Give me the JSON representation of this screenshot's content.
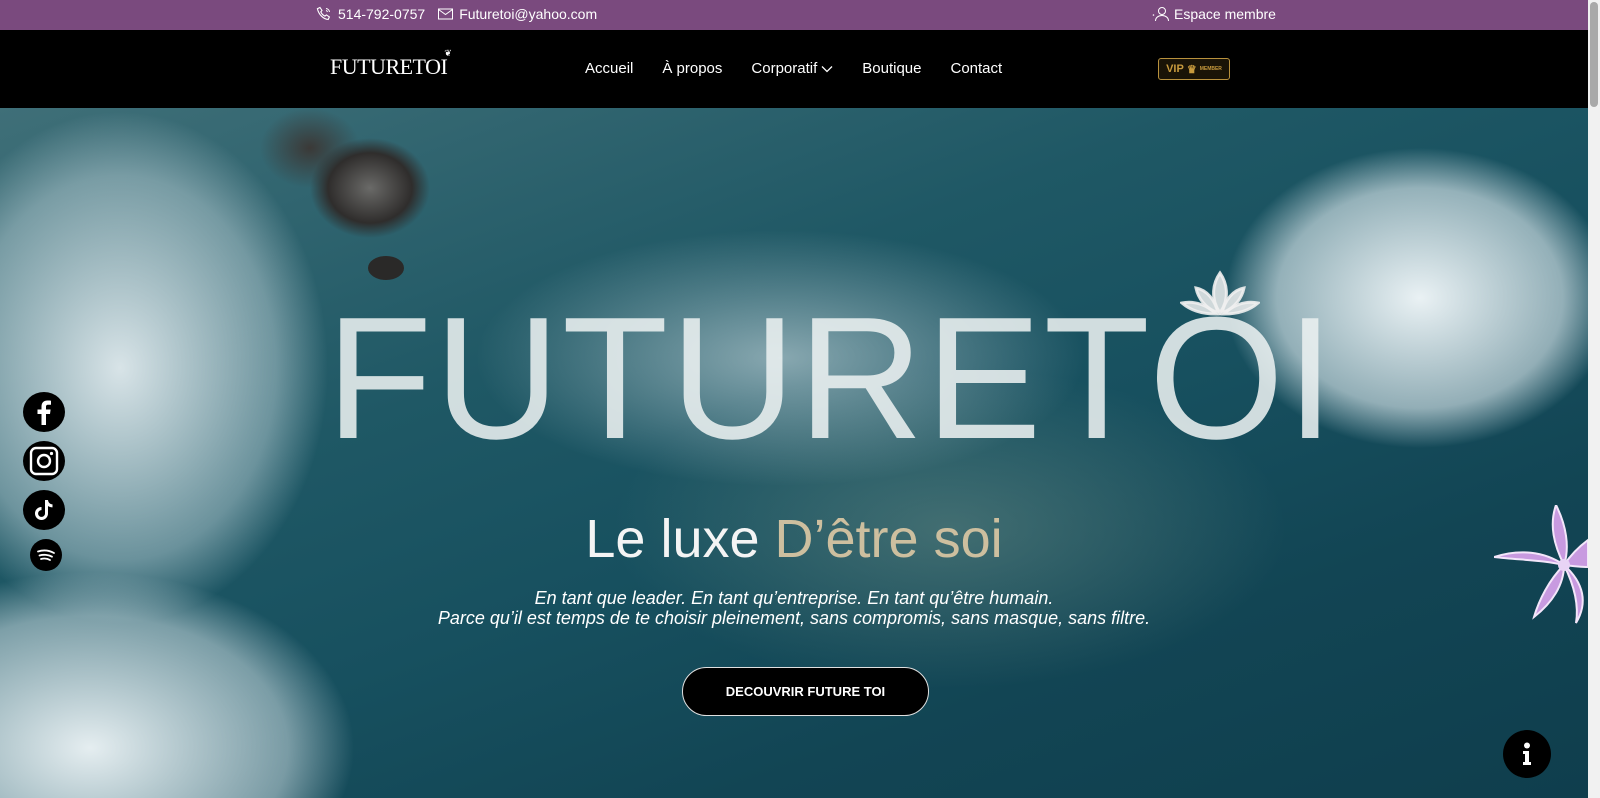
{
  "topbar": {
    "phone": "514-792-0757",
    "email": "Futuretoi@yahoo.com",
    "member_label": "Espace membre"
  },
  "header": {
    "logo_text": "FUTURETOI",
    "nav": {
      "home": "Accueil",
      "about": "À propos",
      "corporate": "Corporatif",
      "shop": "Boutique",
      "contact": "Contact"
    },
    "vip_label": "VIP",
    "vip_sub": "MEMBER"
  },
  "hero": {
    "brand": "FUTURETOI",
    "tagline_main": "Le luxe",
    "tagline_accent": "D’être soi",
    "subline_1": "En tant que leader. En tant qu’entreprise. En tant qu’être humain.",
    "subline_2": "Parce qu’il est temps de te choisir pleinement, sans compromis, sans masque, sans filtre.",
    "cta_label": "DECOUVRIR FUTURE TOI"
  },
  "social": [
    "facebook-icon",
    "instagram-icon",
    "tiktok-icon",
    "spotify-icon"
  ],
  "colors": {
    "topbar": "#7a4a7e",
    "header": "#000000",
    "accent_text": "#cdbf9f",
    "vip_gold": "#c79a3d"
  }
}
